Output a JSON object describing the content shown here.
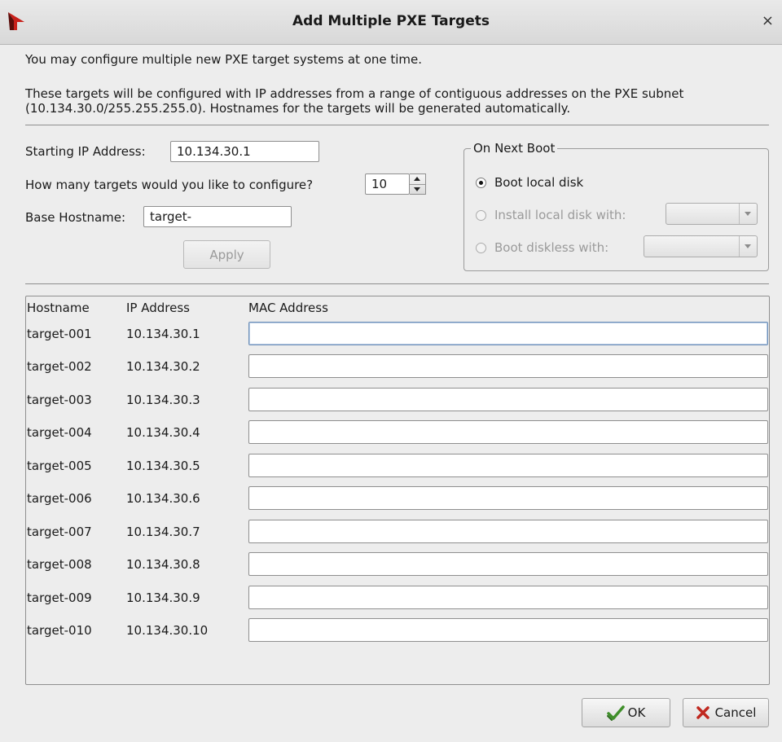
{
  "window": {
    "title": "Add Multiple PXE Targets",
    "close_label": "×"
  },
  "intro": {
    "line1": "You may configure multiple new PXE target systems at one time.",
    "line2": "These targets will be configured with IP addresses from a range of contiguous addresses on the PXE subnet (10.134.30.0/255.255.255.0).  Hostnames for the targets will be generated automatically."
  },
  "form": {
    "start_ip_label": "Starting IP Address:",
    "start_ip_value": "10.134.30.1",
    "count_label": "How many targets would you like to configure?",
    "count_value": "10",
    "base_host_label": "Base Hostname:",
    "base_host_value": "target-",
    "apply_label": "Apply"
  },
  "boot": {
    "group_title": "On Next Boot",
    "options": [
      {
        "label": "Boot local disk",
        "checked": true,
        "enabled": true
      },
      {
        "label": "Install local disk with:",
        "checked": false,
        "enabled": false
      },
      {
        "label": "Boot diskless with:",
        "checked": false,
        "enabled": false
      }
    ]
  },
  "table": {
    "headers": {
      "hostname": "Hostname",
      "ip": "IP Address",
      "mac": "MAC Address"
    },
    "rows": [
      {
        "hostname": "target-001",
        "ip": "10.134.30.1",
        "mac": ""
      },
      {
        "hostname": "target-002",
        "ip": "10.134.30.2",
        "mac": ""
      },
      {
        "hostname": "target-003",
        "ip": "10.134.30.3",
        "mac": ""
      },
      {
        "hostname": "target-004",
        "ip": "10.134.30.4",
        "mac": ""
      },
      {
        "hostname": "target-005",
        "ip": "10.134.30.5",
        "mac": ""
      },
      {
        "hostname": "target-006",
        "ip": "10.134.30.6",
        "mac": ""
      },
      {
        "hostname": "target-007",
        "ip": "10.134.30.7",
        "mac": ""
      },
      {
        "hostname": "target-008",
        "ip": "10.134.30.8",
        "mac": ""
      },
      {
        "hostname": "target-009",
        "ip": "10.134.30.9",
        "mac": ""
      },
      {
        "hostname": "target-010",
        "ip": "10.134.30.10",
        "mac": ""
      }
    ]
  },
  "buttons": {
    "ok_label": "OK",
    "cancel_label": "Cancel"
  },
  "icons": {
    "app": "red-arrow-logo-icon",
    "ok": "green-checkmark-icon",
    "cancel": "red-x-icon"
  },
  "colors": {
    "focus_border": "#6d8fb8",
    "ok_icon": "#3f8f2a",
    "cancel_icon": "#c0281f",
    "app_icon": "#c8201a"
  }
}
